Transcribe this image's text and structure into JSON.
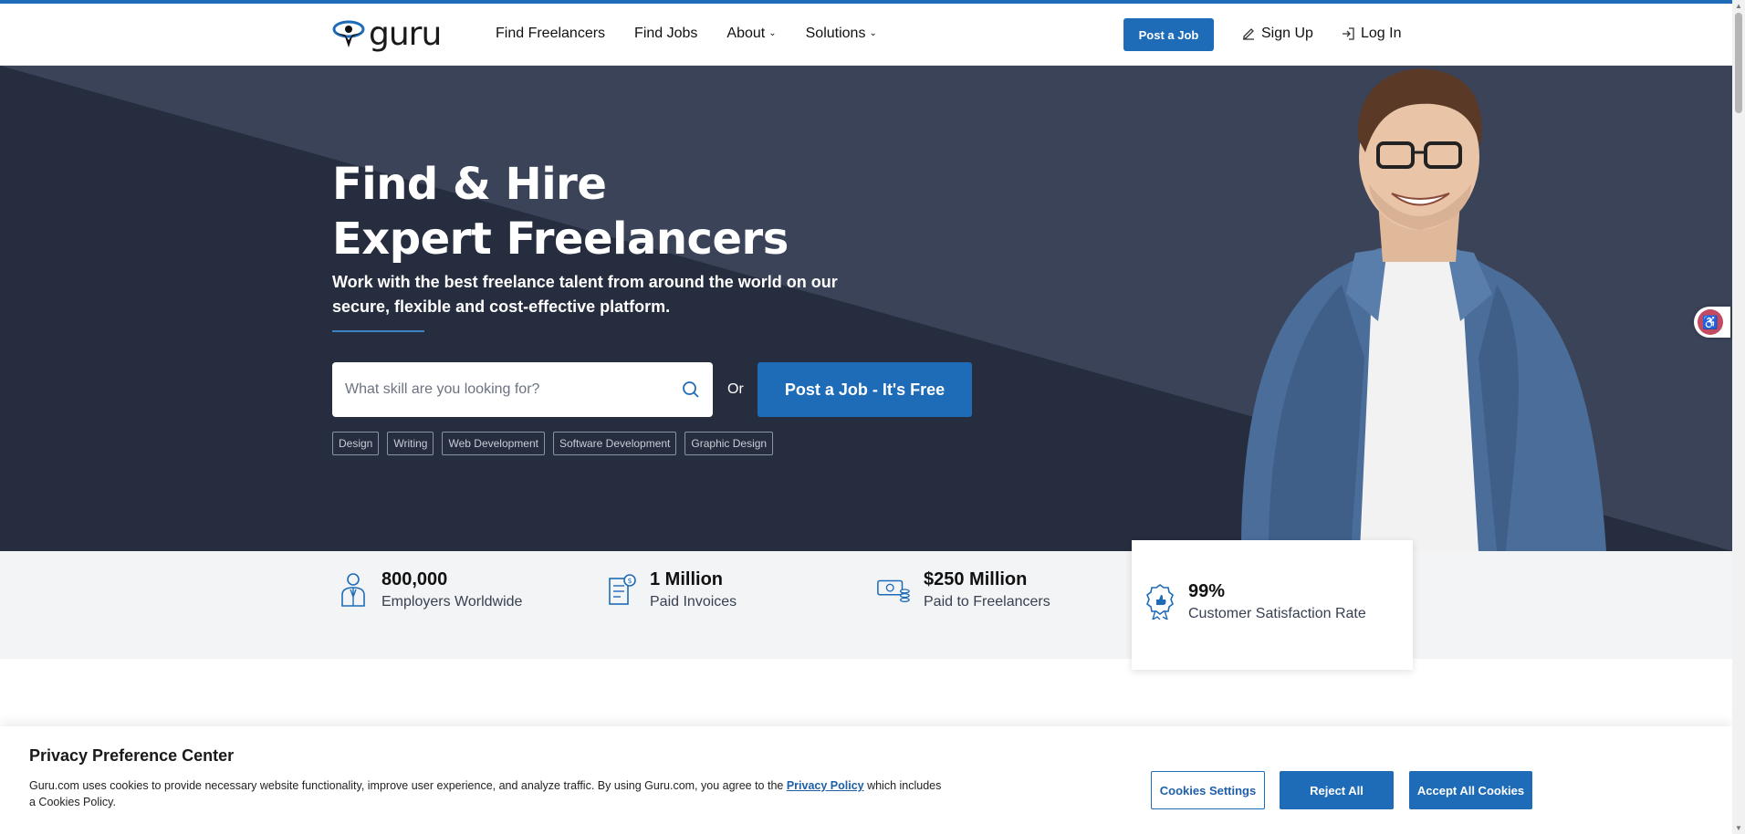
{
  "header": {
    "logo_text": "guru",
    "nav": [
      {
        "label": "Find Freelancers",
        "has_dropdown": false
      },
      {
        "label": "Find Jobs",
        "has_dropdown": false
      },
      {
        "label": "About",
        "has_dropdown": true
      },
      {
        "label": "Solutions",
        "has_dropdown": true
      }
    ],
    "post_job": "Post a Job",
    "sign_up": "Sign Up",
    "log_in": "Log In"
  },
  "hero": {
    "title_line1": "Find & Hire",
    "title_line2": "Expert Freelancers",
    "subtitle": "Work with the best freelance talent from around the world on our secure, flexible and cost-effective platform.",
    "search_placeholder": "What skill are you looking for?",
    "or": "Or",
    "cta": "Post a Job - It's Free",
    "tags": [
      "Design",
      "Writing",
      "Web Development",
      "Software Development",
      "Graphic Design"
    ]
  },
  "stats": [
    {
      "value": "800,000",
      "label": "Employers Worldwide",
      "icon": "employer-icon"
    },
    {
      "value": "1 Million",
      "label": "Paid Invoices",
      "icon": "invoice-icon"
    },
    {
      "value": "$250 Million",
      "label": "Paid to Freelancers",
      "icon": "money-icon"
    },
    {
      "value": "99%",
      "label": "Customer Satisfaction Rate",
      "icon": "award-icon"
    }
  ],
  "cookie": {
    "title": "Privacy Preference Center",
    "text_before": "Guru.com uses cookies to provide necessary website functionality, improve user experience, and analyze traffic. By using Guru.com, you agree to the ",
    "link": "Privacy Policy",
    "text_after": " which includes a Cookies Policy.",
    "settings": "Cookies Settings",
    "reject": "Reject All",
    "accept": "Accept All Cookies"
  },
  "colors": {
    "brand": "#1e6bb8",
    "hero_bg": "#2b3347"
  }
}
